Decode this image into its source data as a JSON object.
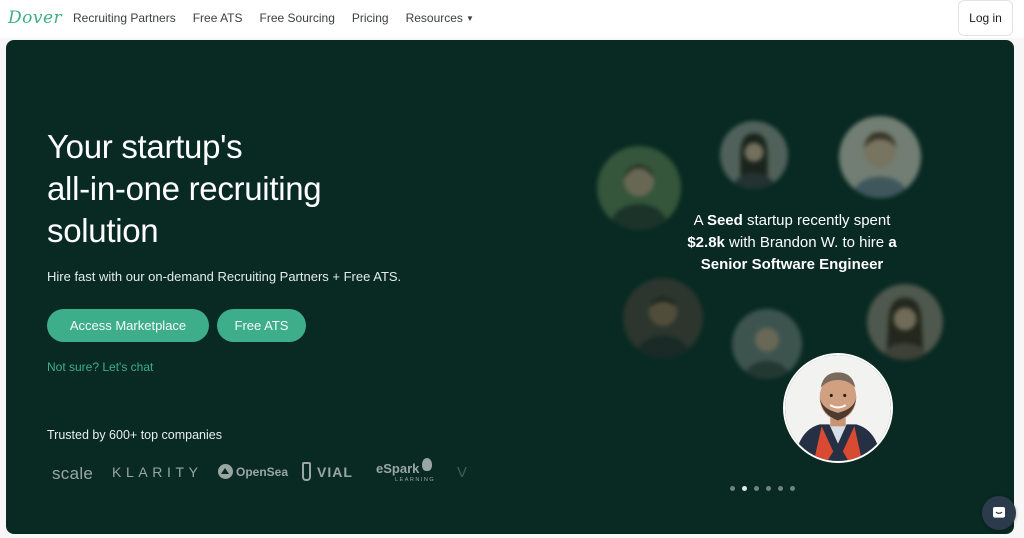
{
  "nav": {
    "logo": "Dover",
    "links": [
      {
        "label": "Recruiting Partners"
      },
      {
        "label": "Free ATS"
      },
      {
        "label": "Free Sourcing"
      },
      {
        "label": "Pricing"
      },
      {
        "label": "Resources"
      }
    ],
    "login_label": "Log in"
  },
  "hero": {
    "headline_line1": "Your startup's",
    "headline_line2": "all-in-one recruiting",
    "headline_line3": "solution",
    "subhead": "Hire fast with our on-demand Recruiting Partners + Free ATS.",
    "primary_button": "Access Marketplace",
    "secondary_button": "Free ATS",
    "chat_link": "Not sure? Let's chat",
    "trusted_text": "Trusted by 600+ top companies",
    "company_logos": {
      "scale": "scale",
      "klarity": "KLARITY",
      "opensea": "OpenSea",
      "vial": "VIAL",
      "espark": "eSpark",
      "espark_sub": "LEARNING",
      "faded": "V"
    }
  },
  "testimonial": {
    "part1": "A ",
    "stage": "Seed",
    "part2": " startup recently spent",
    "amount": "$2.8k",
    "part3": " with Brandon W. to hire ",
    "article": "a",
    "role": "Senior Software Engineer"
  },
  "carousel": {
    "total": 6,
    "active_index": 1
  },
  "colors": {
    "brand_green": "#3eae8a",
    "hero_bg": "#082a22"
  }
}
